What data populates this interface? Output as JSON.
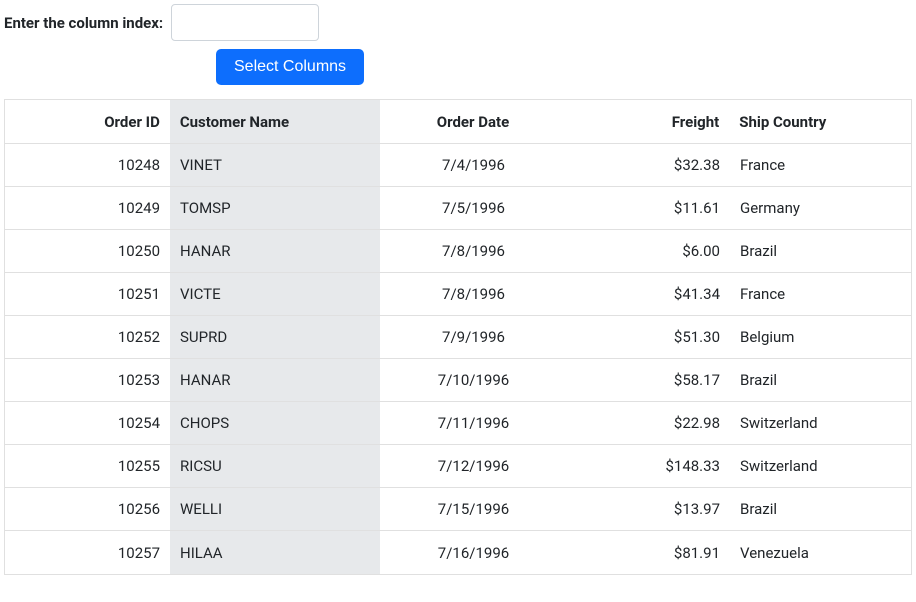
{
  "form": {
    "label": "Enter the column index:",
    "input_value": "",
    "button_label": "Select Columns"
  },
  "grid": {
    "columns": [
      {
        "key": "orderid",
        "header": "Order ID",
        "cls": "col-orderid"
      },
      {
        "key": "customer",
        "header": "Customer Name",
        "cls": "col-customer"
      },
      {
        "key": "date",
        "header": "Order Date",
        "cls": "col-date"
      },
      {
        "key": "freight",
        "header": "Freight",
        "cls": "col-freight"
      },
      {
        "key": "country",
        "header": "Ship Country",
        "cls": "col-country"
      }
    ],
    "rows": [
      {
        "orderid": "10248",
        "customer": "VINET",
        "date": "7/4/1996",
        "freight": "$32.38",
        "country": "France"
      },
      {
        "orderid": "10249",
        "customer": "TOMSP",
        "date": "7/5/1996",
        "freight": "$11.61",
        "country": "Germany"
      },
      {
        "orderid": "10250",
        "customer": "HANAR",
        "date": "7/8/1996",
        "freight": "$6.00",
        "country": "Brazil"
      },
      {
        "orderid": "10251",
        "customer": "VICTE",
        "date": "7/8/1996",
        "freight": "$41.34",
        "country": "France"
      },
      {
        "orderid": "10252",
        "customer": "SUPRD",
        "date": "7/9/1996",
        "freight": "$51.30",
        "country": "Belgium"
      },
      {
        "orderid": "10253",
        "customer": "HANAR",
        "date": "7/10/1996",
        "freight": "$58.17",
        "country": "Brazil"
      },
      {
        "orderid": "10254",
        "customer": "CHOPS",
        "date": "7/11/1996",
        "freight": "$22.98",
        "country": "Switzerland"
      },
      {
        "orderid": "10255",
        "customer": "RICSU",
        "date": "7/12/1996",
        "freight": "$148.33",
        "country": "Switzerland"
      },
      {
        "orderid": "10256",
        "customer": "WELLI",
        "date": "7/15/1996",
        "freight": "$13.97",
        "country": "Brazil"
      },
      {
        "orderid": "10257",
        "customer": "HILAA",
        "date": "7/16/1996",
        "freight": "$81.91",
        "country": "Venezuela"
      }
    ]
  }
}
